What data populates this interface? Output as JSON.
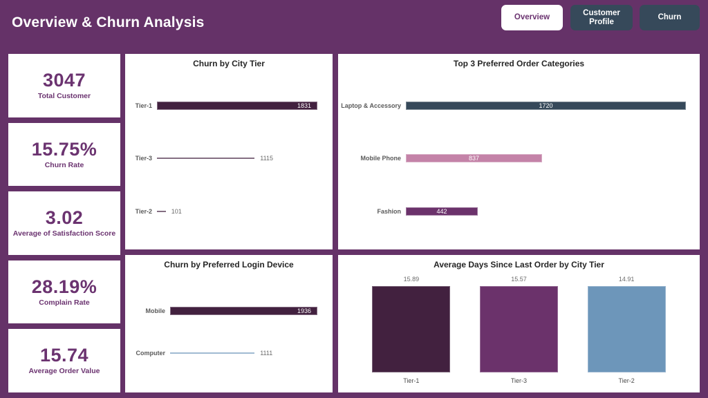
{
  "header": {
    "title": "Overview & Churn Analysis",
    "nav": [
      {
        "label": "Overview",
        "active": true
      },
      {
        "label": "Customer\nProfile",
        "active": false
      },
      {
        "label": "Churn",
        "active": false
      }
    ]
  },
  "kpis": [
    {
      "value": "3047",
      "label": "Total Customer"
    },
    {
      "value": "15.75%",
      "label": "Churn Rate"
    },
    {
      "value": "3.02",
      "label": "Average of Satisfaction Score"
    },
    {
      "value": "28.19%",
      "label": "Complain Rate"
    },
    {
      "value": "15.74",
      "label": "Average Order Value"
    }
  ],
  "colors": {
    "background": "#653268",
    "panel": "#ffffff",
    "accent_purple": "#6b3370",
    "bar_dark_purple": "#42213f",
    "bar_mid_purple": "#6b326b",
    "bar_slate": "#36495a",
    "bar_pink": "#c483a8",
    "bar_blue": "#6d96ba",
    "nav_inactive": "#36495a",
    "label_gray": "#5a5a5a"
  },
  "chart_data": [
    {
      "type": "bar",
      "orientation": "horizontal",
      "title": "Churn by City Tier",
      "categories": [
        "Tier-1",
        "Tier-3",
        "Tier-2"
      ],
      "values": [
        1831,
        1115,
        101
      ],
      "labels": [
        "1831",
        "1115",
        "101"
      ],
      "label_inside": [
        true,
        false,
        false
      ],
      "colors": [
        "#42213f",
        "#42213f",
        "#42213f"
      ],
      "xlabel": "",
      "ylabel": "",
      "xlim": [
        0,
        1831
      ],
      "grid": false,
      "legend": false
    },
    {
      "type": "bar",
      "orientation": "horizontal",
      "title": "Top 3 Preferred Order Categories",
      "categories": [
        "Laptop & Accessory",
        "Mobile Phone",
        "Fashion"
      ],
      "values": [
        1720,
        837,
        442
      ],
      "labels": [
        "1720",
        "837",
        "442"
      ],
      "label_inside": [
        true,
        true,
        true
      ],
      "colors": [
        "#36495a",
        "#c483a8",
        "#6b326b"
      ],
      "xlabel": "",
      "ylabel": "",
      "xlim": [
        0,
        1720
      ],
      "grid": false,
      "legend": false
    },
    {
      "type": "bar",
      "orientation": "horizontal",
      "title": "Churn by Preferred Login Device",
      "categories": [
        "Mobile",
        "Computer"
      ],
      "values": [
        1936,
        1111
      ],
      "labels": [
        "1936",
        "1111"
      ],
      "label_inside": [
        true,
        false
      ],
      "colors": [
        "#42213f",
        "#6d96ba"
      ],
      "xlabel": "",
      "ylabel": "",
      "xlim": [
        0,
        1936
      ],
      "grid": false,
      "legend": false
    },
    {
      "type": "bar",
      "orientation": "vertical",
      "title": "Average Days Since Last Order by City Tier",
      "categories": [
        "Tier-1",
        "Tier-3",
        "Tier-2"
      ],
      "values": [
        15.89,
        15.57,
        14.91
      ],
      "labels": [
        "15.89",
        "15.57",
        "14.91"
      ],
      "colors": [
        "#42213f",
        "#6b326b",
        "#6d96ba"
      ],
      "xlabel": "",
      "ylabel": "",
      "ylim": [
        0,
        16.8
      ],
      "grid": false,
      "legend": false
    }
  ]
}
